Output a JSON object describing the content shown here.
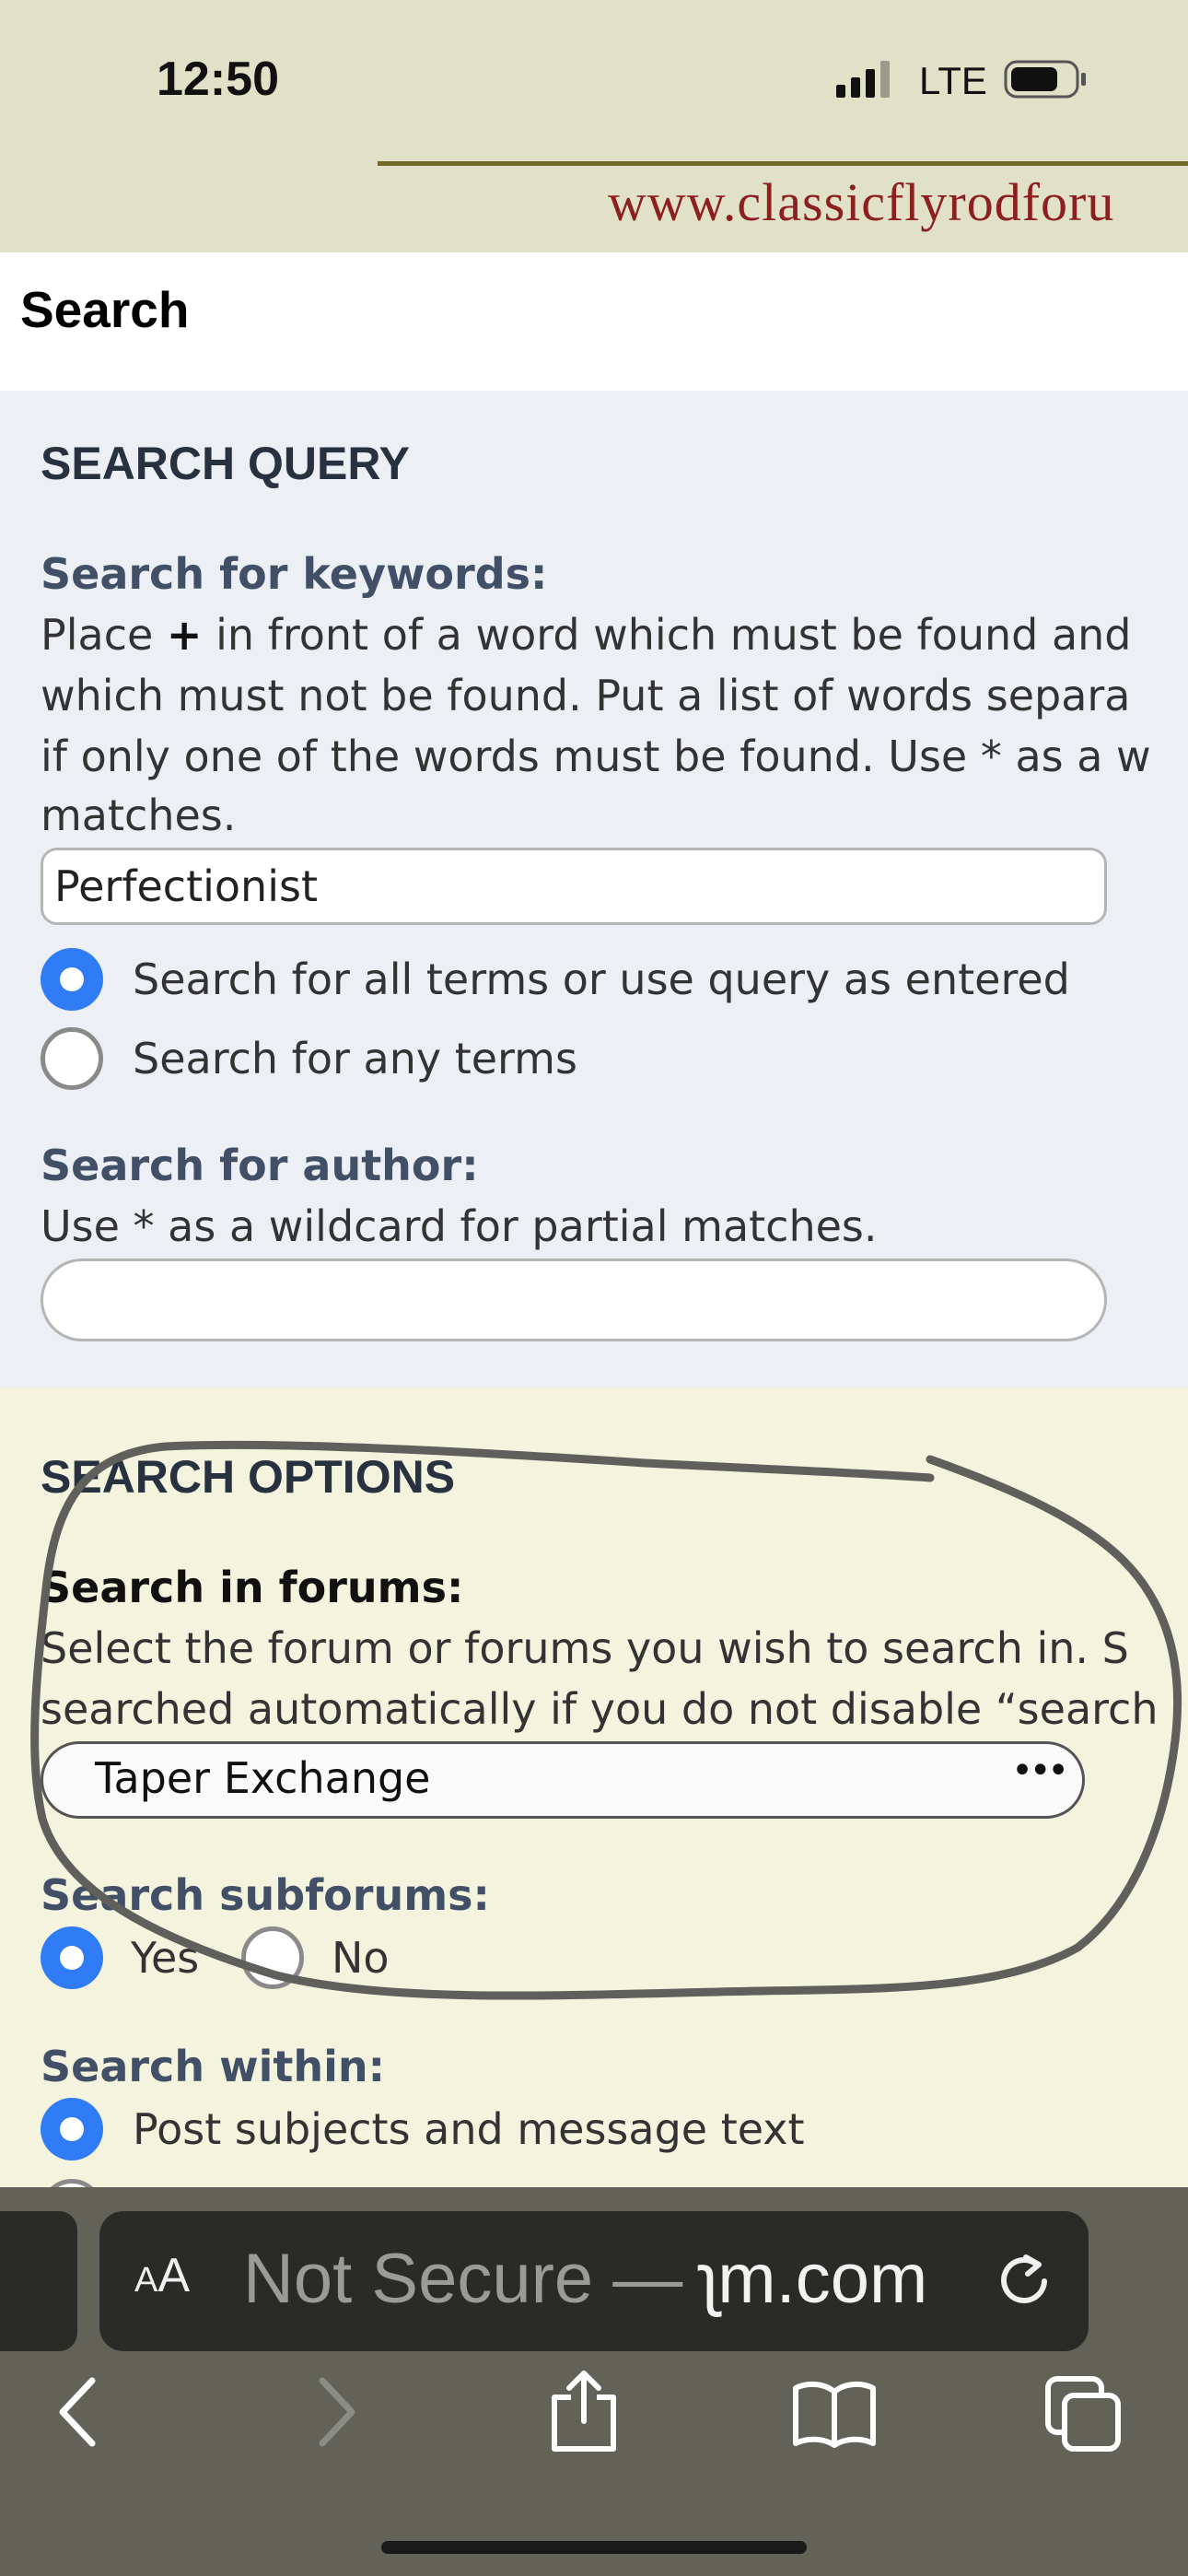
{
  "status_bar": {
    "time": "12:50",
    "network": "LTE",
    "icons": [
      "signal-bars-icon",
      "battery-icon"
    ]
  },
  "banner": {
    "site_name": "www.classicflyrodforu"
  },
  "page": {
    "title": "Search"
  },
  "search_query": {
    "heading": "SEARCH QUERY",
    "keywords_label": "Search for keywords:",
    "keywords_help": [
      {
        "before": "Place ",
        "bold": "+",
        "after": " in front of a word which must be found and"
      },
      {
        "before": "which must not be found. Put a list of words separa",
        "bold": "",
        "after": ""
      },
      {
        "before": "if only one of the words must be found. Use * as a w",
        "bold": "",
        "after": ""
      },
      {
        "before": "matches.",
        "bold": "",
        "after": ""
      }
    ],
    "keywords_value": "Perfectionist",
    "match_options": [
      {
        "label": "Search for all terms or use query as entered",
        "selected": true
      },
      {
        "label": "Search for any terms",
        "selected": false
      }
    ],
    "author_label": "Search for author:",
    "author_help": "Use * as a wildcard for partial matches.",
    "author_value": ""
  },
  "search_options": {
    "heading": "SEARCH OPTIONS",
    "forums_label": "Search in forums:",
    "forums_help": [
      "Select the forum or forums you wish to search in. S",
      "searched automatically if you do not disable “search"
    ],
    "forum_selected": "Taper Exchange",
    "subforums_label": "Search subforums:",
    "subforum_options": [
      {
        "label": "Yes",
        "selected": true
      },
      {
        "label": "No",
        "selected": false
      }
    ],
    "within_label": "Search within:",
    "within_options": [
      {
        "label": "Post subjects and message text",
        "selected": true
      }
    ]
  },
  "annotation": {
    "shape": "hand-drawn circle",
    "color": "#5f605b"
  },
  "safari": {
    "aa_label_small": "A",
    "aa_label_big": "A",
    "address_dim": "Not Secure — ",
    "address_host": "ʅm.com",
    "toolbar_icons": [
      "back-icon",
      "forward-icon",
      "share-icon",
      "bookmarks-icon",
      "tabs-icon"
    ]
  },
  "colors": {
    "accent": "#2f7cf6",
    "banner_text": "#8c1f1f",
    "query_panel": "#eceff4",
    "options_panel": "#f3f3de"
  }
}
